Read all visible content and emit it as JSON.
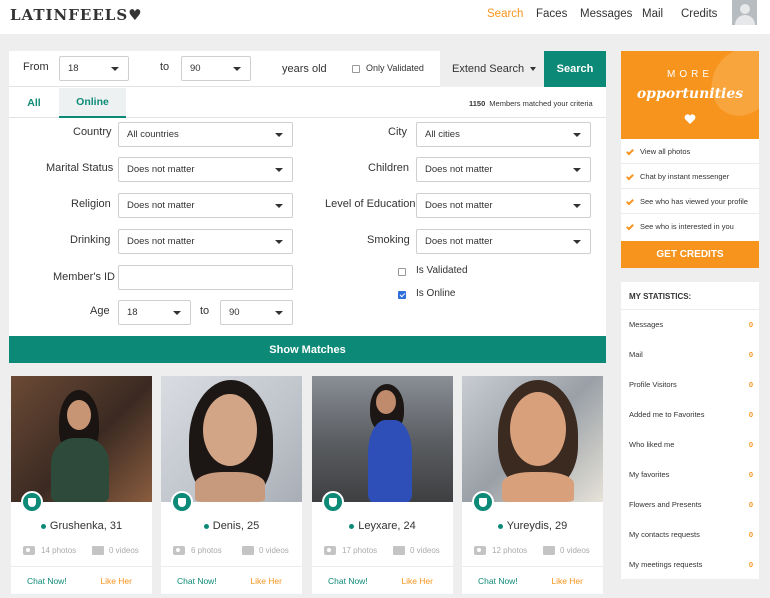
{
  "header": {
    "logo": "LATINFEELS",
    "logo_heart": "♥",
    "nav": [
      "Search",
      "Faces",
      "Messages",
      "Mail",
      "Credits"
    ],
    "active_nav": "Search"
  },
  "search": {
    "from_label": "From",
    "from_value": "18",
    "to_label": "to",
    "to_value": "90",
    "years_old": "years old",
    "only_validated": "Only Validated",
    "extend_search": "Extend Search",
    "search_button": "Search",
    "tabs": [
      "All",
      "Online"
    ],
    "matched_count": "1150",
    "matched_text": "Members matched your criteria",
    "fields": {
      "country_label": "Country",
      "country_value": "All countries",
      "city_label": "City",
      "city_value": "All cities",
      "marital_label": "Marital Status",
      "marital_value": "Does not matter",
      "children_label": "Children",
      "children_value": "Does not matter",
      "religion_label": "Religion",
      "religion_value": "Does not matter",
      "education_label": "Level of Education",
      "education_value": "Does not matter",
      "drinking_label": "Drinking",
      "drinking_value": "Does not matter",
      "smoking_label": "Smoking",
      "smoking_value": "Does not matter",
      "member_id_label": "Member's ID",
      "member_id_value": "",
      "is_validated": "Is Validated",
      "is_online": "Is Online",
      "age_label": "Age",
      "age_from": "18",
      "age_to_label": "to",
      "age_to": "90"
    },
    "show_matches": "Show Matches"
  },
  "profiles": [
    {
      "name": "Grushenka, 31",
      "photos": "14 photos",
      "videos": "0 videos",
      "chat": "Chat Now!",
      "like": "Like Her"
    },
    {
      "name": "Denis, 25",
      "photos": "6 photos",
      "videos": "0 videos",
      "chat": "Chat Now!",
      "like": "Like Her"
    },
    {
      "name": "Leyxare, 24",
      "photos": "17 photos",
      "videos": "0 videos",
      "chat": "Chat Now!",
      "like": "Like Her"
    },
    {
      "name": "Yureydis, 29",
      "photos": "12 photos",
      "videos": "0 videos",
      "chat": "Chat Now!",
      "like": "Like Her"
    }
  ],
  "promo": {
    "more": "MORE",
    "opportunities": "opportunities",
    "perks": [
      "View all photos",
      "Chat by instant messenger",
      "See who has viewed your profile",
      "See who is interested in you"
    ],
    "get_credits": "GET CREDITS"
  },
  "stats": {
    "title": "MY STATISTICS:",
    "items": [
      {
        "label": "Messages",
        "value": "0"
      },
      {
        "label": "Mail",
        "value": "0"
      },
      {
        "label": "Profile Visitors",
        "value": "0"
      },
      {
        "label": "Added me to Favorites",
        "value": "0"
      },
      {
        "label": "Who liked me",
        "value": "0"
      },
      {
        "label": "My favorites",
        "value": "0"
      },
      {
        "label": "Flowers and Presents",
        "value": "0"
      },
      {
        "label": "My contacts requests",
        "value": "0"
      },
      {
        "label": "My meetings requests",
        "value": "0"
      }
    ]
  },
  "colors": {
    "accent": "#f7941d",
    "brand": "#0d8a77"
  }
}
